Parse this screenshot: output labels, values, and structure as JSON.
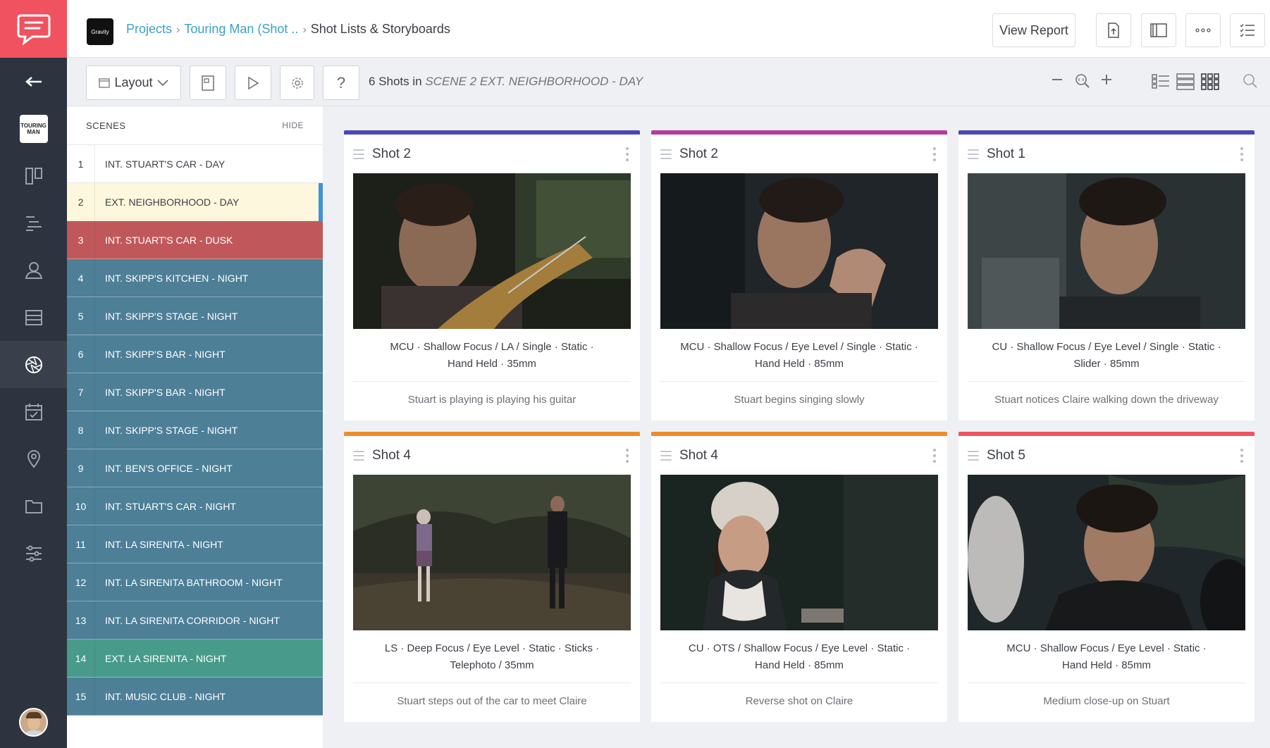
{
  "colors": {
    "accent_red": "#f0525f",
    "rail_bg": "#2d3440",
    "link_blue": "#3aa2c5",
    "selected_indicator": "#3d93d8"
  },
  "rail": {
    "project_thumb_label": "TOURING MAN",
    "items": [
      "back-arrow-icon",
      "project-thumbnail",
      "board-icon",
      "timeline-icon",
      "characters-icon",
      "list-icon",
      "shot-lens-icon",
      "calendar-icon",
      "location-pin-icon",
      "folder-icon",
      "sliders-icon"
    ]
  },
  "topbar": {
    "brand_label": "Gravity",
    "crumbs": [
      "Projects",
      "Touring Man (Shot ..",
      "Shot Lists & Storyboards"
    ],
    "view_report": "View Report"
  },
  "toolbar": {
    "layout_label": "Layout",
    "help_label": "?",
    "shots_count_prefix": "6 Shots in",
    "scene_name": "SCENE 2 EXT. NEIGHBORHOOD - DAY"
  },
  "scenes": {
    "title": "SCENES",
    "hide_label": "HIDE",
    "rows": [
      {
        "num": "1",
        "name": "INT. STUART'S CAR - DAY",
        "style": "white"
      },
      {
        "num": "2",
        "name": "EXT. NEIGHBORHOOD - DAY",
        "style": "cream"
      },
      {
        "num": "3",
        "name": "INT. STUART'S CAR - DUSK",
        "style": "red"
      },
      {
        "num": "4",
        "name": "INT. SKIPP'S KITCHEN - NIGHT",
        "style": "blue"
      },
      {
        "num": "5",
        "name": "INT. SKIPP'S STAGE - NIGHT",
        "style": "blue"
      },
      {
        "num": "6",
        "name": "INT. SKIPP'S BAR - NIGHT",
        "style": "blue"
      },
      {
        "num": "7",
        "name": "INT. SKIPP'S BAR - NIGHT",
        "style": "blue"
      },
      {
        "num": "8",
        "name": "INT. SKIPP'S STAGE - NIGHT",
        "style": "blue"
      },
      {
        "num": "9",
        "name": "INT. BEN'S OFFICE - NIGHT",
        "style": "blue"
      },
      {
        "num": "10",
        "name": "INT. STUART'S CAR - NIGHT",
        "style": "blue"
      },
      {
        "num": "11",
        "name": "INT. LA SIRENITA - NIGHT",
        "style": "blue"
      },
      {
        "num": "12",
        "name": "INT. LA SIRENITA BATHROOM - NIGHT",
        "style": "blue"
      },
      {
        "num": "13",
        "name": "INT. LA SIRENITA CORRIDOR - NIGHT",
        "style": "blue"
      },
      {
        "num": "14",
        "name": "EXT. LA SIRENITA - NIGHT",
        "style": "green"
      },
      {
        "num": "15",
        "name": "INT. MUSIC CLUB - NIGHT",
        "style": "blue"
      }
    ]
  },
  "shots": [
    {
      "title": "Shot 2",
      "color": "#4a47b8",
      "specs_line1": "MCU  ·  Shallow Focus / LA / Single  ·  Static  ·",
      "specs_line2": "Hand Held  ·  35mm",
      "desc": "Stuart is playing is playing his guitar"
    },
    {
      "title": "Shot 2",
      "color": "#b83a9c",
      "specs_line1": "MCU  ·  Shallow Focus / Eye Level / Single  ·  Static  ·",
      "specs_line2": "Hand Held  ·  85mm",
      "desc": "Stuart begins singing slowly"
    },
    {
      "title": "Shot 1",
      "color": "#4a47b8",
      "specs_line1": "CU  ·  Shallow Focus / Eye Level / Single  ·  Static  ·",
      "specs_line2": "Slider  ·  85mm",
      "desc": "Stuart notices Claire walking down the driveway"
    },
    {
      "title": "Shot 4",
      "color": "#f08a2c",
      "specs_line1": "LS  ·  Deep Focus / Eye Level  ·  Static  ·  Sticks  ·",
      "specs_line2": "Telephoto / 35mm",
      "desc": "Stuart steps out of the car to meet Claire"
    },
    {
      "title": "Shot 4",
      "color": "#f08a2c",
      "specs_line1": "CU  ·  OTS / Shallow Focus / Eye Level  ·  Static  ·",
      "specs_line2": "Hand Held  ·  85mm",
      "desc": "Reverse shot on Claire"
    },
    {
      "title": "Shot 5",
      "color": "#ef5361",
      "specs_line1": "MCU  ·  Shallow Focus / Eye Level  ·  Static  ·",
      "specs_line2": "Hand Held  ·  85mm",
      "desc": "Medium close-up on Stuart"
    }
  ]
}
